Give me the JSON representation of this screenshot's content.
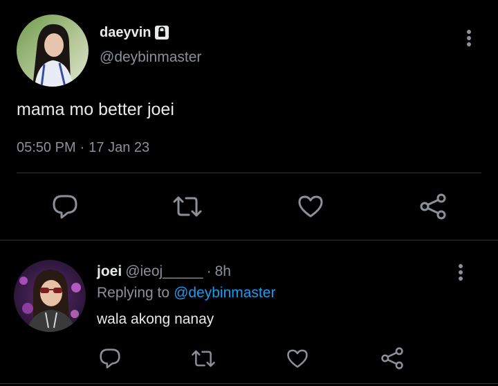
{
  "tweet": {
    "display_name": "daeyvin",
    "handle": "@deybinmaster",
    "text": "mama mo better joei",
    "time": "05:50 PM",
    "separator": "·",
    "date": "17 Jan 23",
    "locked_icon": "lock-icon",
    "actions": [
      "reply-icon",
      "retweet-icon",
      "like-icon",
      "share-icon"
    ]
  },
  "reply": {
    "display_name": "joei",
    "handle": "@ieoj_____",
    "separator": "·",
    "age": "8h",
    "replying_prefix": "Replying to",
    "replying_handle": "@deybinmaster",
    "text": "wala akong nanay",
    "actions": [
      "reply-icon",
      "retweet-icon",
      "like-icon",
      "share-icon"
    ]
  },
  "colors": {
    "background": "#000000",
    "text": "#e7e9ea",
    "muted": "#8b9198",
    "link": "#1d9bf0",
    "divider": "#2f3336"
  }
}
